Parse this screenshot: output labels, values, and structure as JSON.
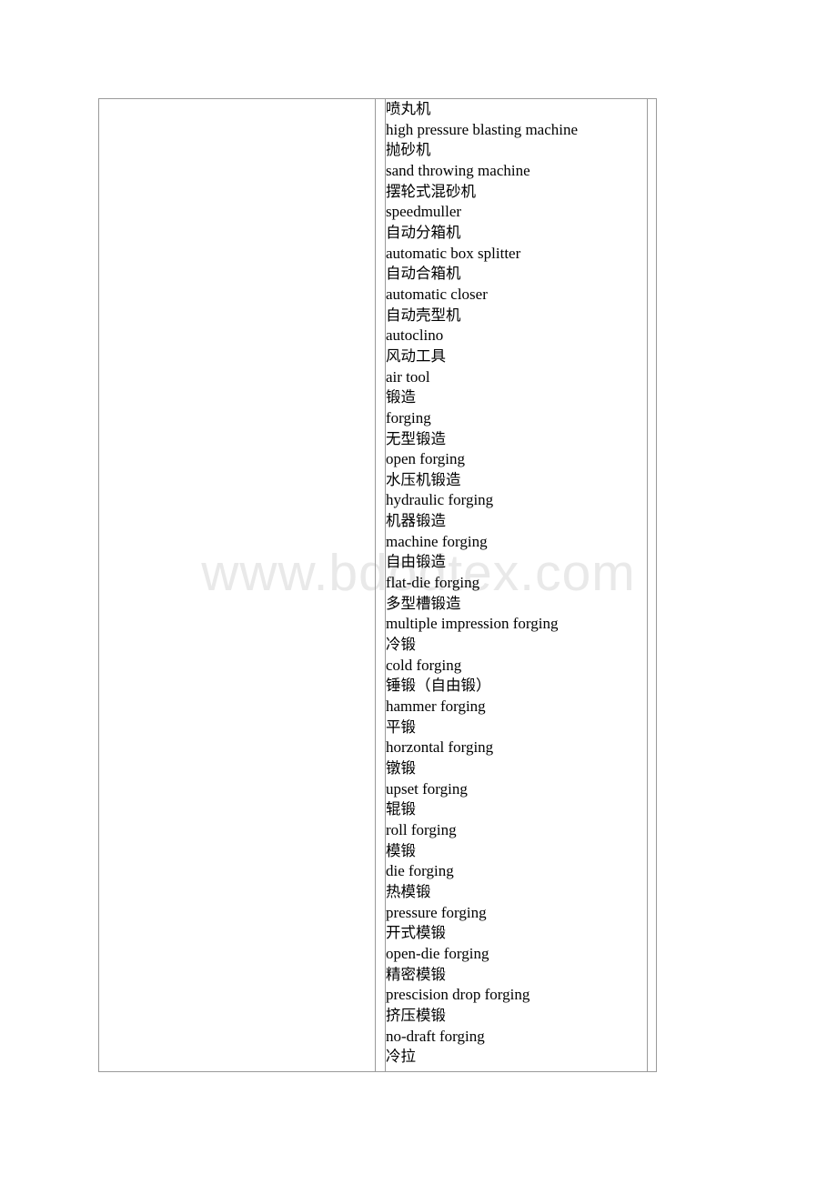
{
  "document": {
    "watermark": "www.bdodtex.com",
    "background_color": "#ffffff",
    "border_color": "#9a9a9a",
    "text_color": "#000000",
    "watermark_color": "#e9e9e9"
  },
  "table": {
    "columns": [
      {
        "name": "left-empty-column",
        "content": ""
      },
      {
        "name": "gap-column-a",
        "content": ""
      },
      {
        "name": "glossary-column",
        "content": "terms"
      },
      {
        "name": "gap-column-b",
        "content": ""
      }
    ]
  },
  "glossary": {
    "entries": [
      {
        "zh": "喷丸机",
        "en": "high pressure blasting machine"
      },
      {
        "zh": "抛砂机",
        "en": "sand throwing machine"
      },
      {
        "zh": "摆轮式混砂机",
        "en": "speedmuller"
      },
      {
        "zh": "自动分箱机",
        "en": "automatic box splitter"
      },
      {
        "zh": "自动合箱机",
        "en": "automatic closer"
      },
      {
        "zh": "自动壳型机",
        "en": "autoclino"
      },
      {
        "zh": "风动工具",
        "en": "air tool"
      },
      {
        "zh": "锻造",
        "en": "forging"
      },
      {
        "zh": "无型锻造",
        "en": "open forging"
      },
      {
        "zh": "水压机锻造",
        "en": "hydraulic forging"
      },
      {
        "zh": "机器锻造",
        "en": "machine forging"
      },
      {
        "zh": "自由锻造",
        "en": "flat-die forging"
      },
      {
        "zh": "多型槽锻造",
        "en": "multiple impression forging"
      },
      {
        "zh": "冷锻",
        "en": "cold forging"
      },
      {
        "zh": "锤锻（自由锻）",
        "en": "hammer forging"
      },
      {
        "zh": "平锻",
        "en": "horzontal forging"
      },
      {
        "zh": "镦锻",
        "en": "upset forging"
      },
      {
        "zh": "辊锻",
        "en": "roll forging"
      },
      {
        "zh": "模锻",
        "en": "die forging"
      },
      {
        "zh": "热模锻",
        "en": "pressure forging"
      },
      {
        "zh": "开式模锻",
        "en": "open-die forging"
      },
      {
        "zh": "精密模锻",
        "en": "prescision drop forging"
      },
      {
        "zh": "挤压模锻",
        "en": "no-draft forging"
      }
    ],
    "trailing_term": "冷拉"
  }
}
